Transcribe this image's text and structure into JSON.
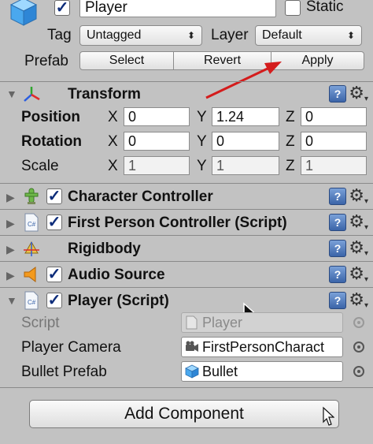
{
  "header": {
    "object_active": true,
    "object_name": "Player",
    "static_label": "Static",
    "static_checked": false,
    "tag_label": "Tag",
    "tag_value": "Untagged",
    "layer_label": "Layer",
    "layer_value": "Default",
    "prefab_label": "Prefab",
    "prefab_buttons": {
      "select": "Select",
      "revert": "Revert",
      "apply": "Apply"
    }
  },
  "transform": {
    "title": "Transform",
    "rows": [
      {
        "label": "Position",
        "x": "0",
        "y": "1.24",
        "z": "0"
      },
      {
        "label": "Rotation",
        "x": "0",
        "y": "0",
        "z": "0"
      },
      {
        "label": "Scale",
        "x": "1",
        "y": "1",
        "z": "1"
      }
    ],
    "axes": {
      "x": "X",
      "y": "Y",
      "z": "Z"
    }
  },
  "components": [
    {
      "title": "Character Controller",
      "enabled": true
    },
    {
      "title": "First Person Controller (Script)",
      "enabled": true
    },
    {
      "title": "Rigidbody"
    },
    {
      "title": "Audio Source",
      "enabled": true
    },
    {
      "title": "Player (Script)",
      "enabled": true
    }
  ],
  "player_script": {
    "fields": [
      {
        "label": "Script",
        "value": "Player",
        "disabled": true
      },
      {
        "label": "Player Camera",
        "value": "FirstPersonCharact"
      },
      {
        "label": "Bullet Prefab",
        "value": "Bullet"
      }
    ]
  },
  "add_component_label": "Add Component",
  "colors": {
    "annotation_arrow": "#d41c1c",
    "help_icon": "#3b64a8",
    "panel_bg": "#c2c2c2"
  },
  "icons": {
    "object": "cube-icon",
    "transform": "transform-axes-icon",
    "character_controller": "character-controller-icon",
    "script": "script-file-icon",
    "rigidbody": "rigidbody-icon",
    "audio": "speaker-icon",
    "help": "book-help-icon",
    "settings": "gear-icon"
  }
}
